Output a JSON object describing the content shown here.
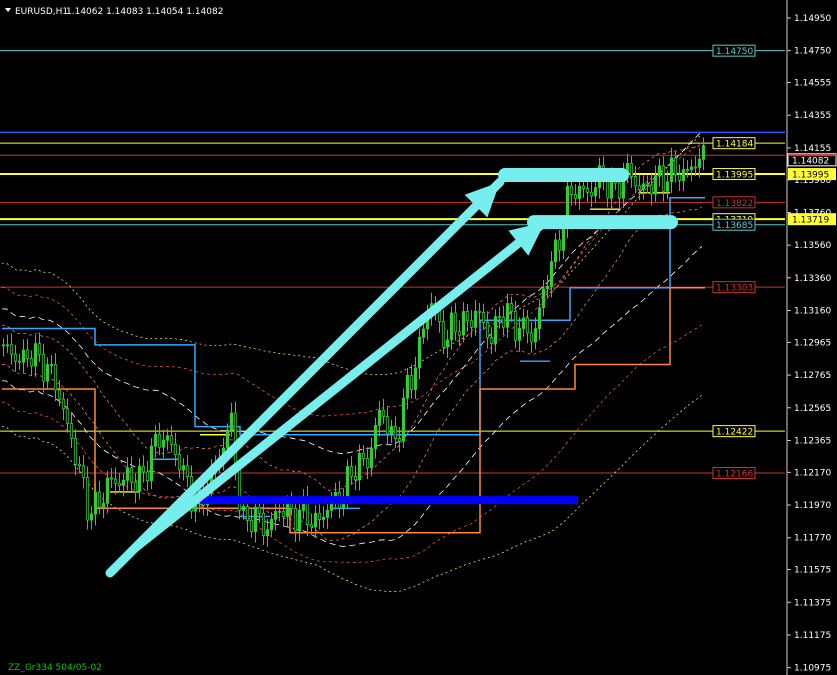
{
  "header": {
    "symbol": "EURUSD,H1",
    "ohlc": "1.14062 1.14083 1.14054 1.14082"
  },
  "footer": {
    "text": "ZZ_Gr334 504/05-02"
  },
  "colors": {
    "background": "#000000",
    "candle": "#33cc33",
    "yellow": "#ffff33",
    "red_level": "#cc3333",
    "teal_level": "#55cccc",
    "blue_level": "#3355ff",
    "light_blue": "#33aaff",
    "orange": "#ff8833",
    "arrow": "#77eeee",
    "blue_bar": "#0000ff"
  },
  "chart_data": {
    "type": "candlestick",
    "ylim": [
      1.1093,
      1.1506
    ],
    "y_ticks": [
      "1.14950",
      "1.14750",
      "1.14555",
      "1.14355",
      "1.14155",
      "1.13960",
      "1.13760",
      "1.13560",
      "1.13360",
      "1.13160",
      "1.12965",
      "1.12765",
      "1.12565",
      "1.12365",
      "1.12170",
      "1.11970",
      "1.11770",
      "1.11575",
      "1.11375",
      "1.11175",
      "1.10975"
    ],
    "current_price": "1.14082",
    "levels": [
      {
        "value": 1.1475,
        "label": "1.14750",
        "color": "#55cccc",
        "kind": "teal"
      },
      {
        "value": 1.1425,
        "label": "",
        "color": "#3355ff",
        "kind": "blue"
      },
      {
        "value": 1.14184,
        "label": "1.14184",
        "color": "#ffff33",
        "kind": "yellow-thin"
      },
      {
        "value": 1.1411,
        "label": "",
        "color": "#cc3333",
        "kind": "red-thin"
      },
      {
        "value": 1.13995,
        "label": "1.13995",
        "color": "#ffff33",
        "kind": "yellow-bold"
      },
      {
        "value": 1.13822,
        "label": "1.13822",
        "color": "#cc3333",
        "kind": "red"
      },
      {
        "value": 1.13719,
        "label": "1.13719",
        "color": "#ffff33",
        "kind": "yellow-bold"
      },
      {
        "value": 1.13685,
        "label": "1.13685",
        "color": "#55cccc",
        "kind": "teal"
      },
      {
        "value": 1.13303,
        "label": "1.13303",
        "color": "#cc3333",
        "kind": "red"
      },
      {
        "value": 1.12422,
        "label": "1.12422",
        "color": "#ffff33",
        "kind": "yellow-thin"
      },
      {
        "value": 1.12166,
        "label": "1.12166",
        "color": "#cc3333",
        "kind": "red"
      }
    ],
    "anchors": [
      [
        1.129,
        0
      ],
      [
        1.1288,
        20
      ],
      [
        1.1285,
        45
      ],
      [
        1.124,
        70
      ],
      [
        1.1195,
        85
      ],
      [
        1.12,
        100
      ],
      [
        1.1215,
        115
      ],
      [
        1.121,
        135
      ],
      [
        1.1228,
        150
      ],
      [
        1.1242,
        165
      ],
      [
        1.121,
        185
      ],
      [
        1.1195,
        200
      ],
      [
        1.1225,
        215
      ],
      [
        1.1245,
        230
      ],
      [
        1.119,
        240
      ],
      [
        1.1185,
        265
      ],
      [
        1.1195,
        285
      ],
      [
        1.1188,
        310
      ],
      [
        1.1192,
        325
      ],
      [
        1.121,
        345
      ],
      [
        1.1232,
        370
      ],
      [
        1.1255,
        380
      ],
      [
        1.1235,
        395
      ],
      [
        1.1265,
        405
      ],
      [
        1.13,
        420
      ],
      [
        1.132,
        430
      ],
      [
        1.1298,
        445
      ],
      [
        1.131,
        460
      ],
      [
        1.1312,
        475
      ],
      [
        1.1302,
        490
      ],
      [
        1.1315,
        505
      ],
      [
        1.1305,
        520
      ],
      [
        1.1298,
        530
      ],
      [
        1.1335,
        545
      ],
      [
        1.135,
        555
      ],
      [
        1.1385,
        565
      ],
      [
        1.139,
        585
      ],
      [
        1.1395,
        600
      ],
      [
        1.1392,
        615
      ],
      [
        1.14,
        630
      ],
      [
        1.1388,
        645
      ],
      [
        1.14,
        660
      ],
      [
        1.1398,
        675
      ],
      [
        1.1405,
        690
      ],
      [
        1.1408,
        704
      ]
    ]
  }
}
